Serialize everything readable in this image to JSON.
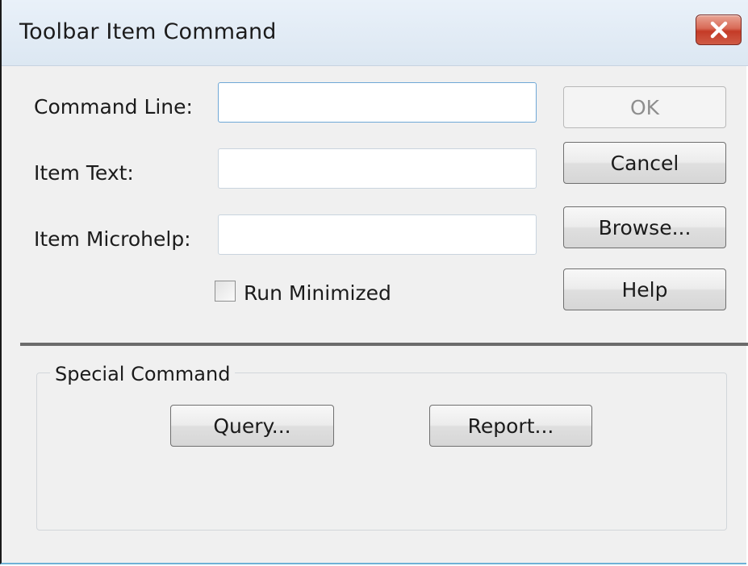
{
  "window": {
    "title": "Toolbar Item Command",
    "close_symbol": "X"
  },
  "form": {
    "command_line_label": "Command Line:",
    "item_text_label": "Item Text:",
    "item_microhelp_label": "Item Microhelp:",
    "command_line_value": "",
    "item_text_value": "",
    "item_microhelp_value": "",
    "run_minimized_label": "Run Minimized",
    "run_minimized_checked": false
  },
  "buttons": {
    "ok": "OK",
    "cancel": "Cancel",
    "browse": "Browse...",
    "help": "Help"
  },
  "special_command": {
    "title": "Special Command",
    "query": "Query...",
    "report": "Report..."
  },
  "colors": {
    "close_button": "#c43b27",
    "field_focus_border": "#6fa8d6"
  },
  "icons": {
    "close": "close-icon"
  }
}
